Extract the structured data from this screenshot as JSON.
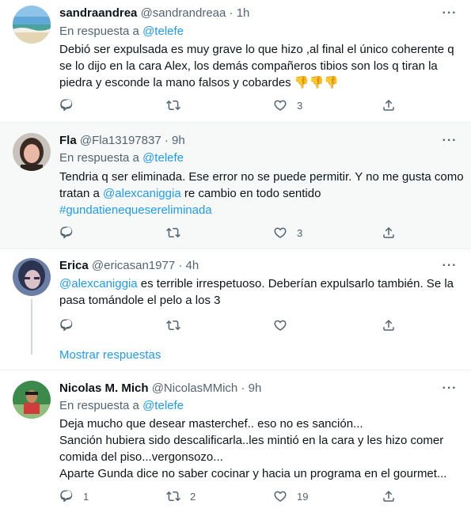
{
  "tweets": [
    {
      "name": "sandraandrea",
      "handle": "@sandrandreaa",
      "dot": "·",
      "time": "1h",
      "reply_prefix": "En respuesta a",
      "reply_to": "@telefe",
      "lines": [
        "Debió ser expulsada es muy grave lo que hizo ,al final el único coherente q",
        "se lo dijo en la cara Alex, los demás compañeros tibios son los q tiran la",
        "piedra y esconde la mano falsos y cobardes 👎👎👎"
      ],
      "replies": "",
      "retweets": "",
      "likes": "3"
    },
    {
      "name": "Fla",
      "handle": "@Fla13197837",
      "dot": "·",
      "time": "9h",
      "reply_prefix": "En respuesta a",
      "reply_to": "@telefe",
      "line1": "Tendria q ser eliminada. Ese error no se puede permitir. Y no me gusta como",
      "line2_pre": "tratan a ",
      "line2_mention": "@alexcaniggia",
      "line2_post": " re cambio en todo  sentido",
      "hashtag": "#gundatienequesereliminada",
      "replies": "",
      "retweets": "",
      "likes": "3"
    },
    {
      "name": "Erica",
      "handle": "@ericasan1977",
      "dot": "·",
      "time": "4h",
      "mention": "@alexcaniggia",
      "line1_post": " es terrible irrespetuoso. Deberían expulsarlo también. Se la",
      "line2": "pasa tomándole el pelo a los 3",
      "replies": "",
      "retweets": "",
      "likes": "",
      "show_replies": "Mostrar respuestas"
    },
    {
      "name": "Nicolas M. Mich",
      "handle": "@NicolasMMich",
      "dot": "·",
      "time": "9h",
      "reply_prefix": "En respuesta a",
      "reply_to": "@telefe",
      "lines": [
        "Deja mucho que desear masterchef.. eso no es sanción...",
        "Sanción hubiera sido descalificarla..les mintió en la cara y les hizo comer",
        "comida del piso...vergonsozo...",
        "Aparte Gunda dice no saber cocinar y hacia un programa en el gourmet..."
      ],
      "replies": "1",
      "retweets": "2",
      "likes": "19"
    }
  ],
  "more_icon": "···",
  "colors": {
    "accent": "#1d9bf0",
    "muted": "#536471",
    "text": "#0f1419",
    "highlight_bg": "#f7f9f9",
    "border": "#eff3f4"
  }
}
